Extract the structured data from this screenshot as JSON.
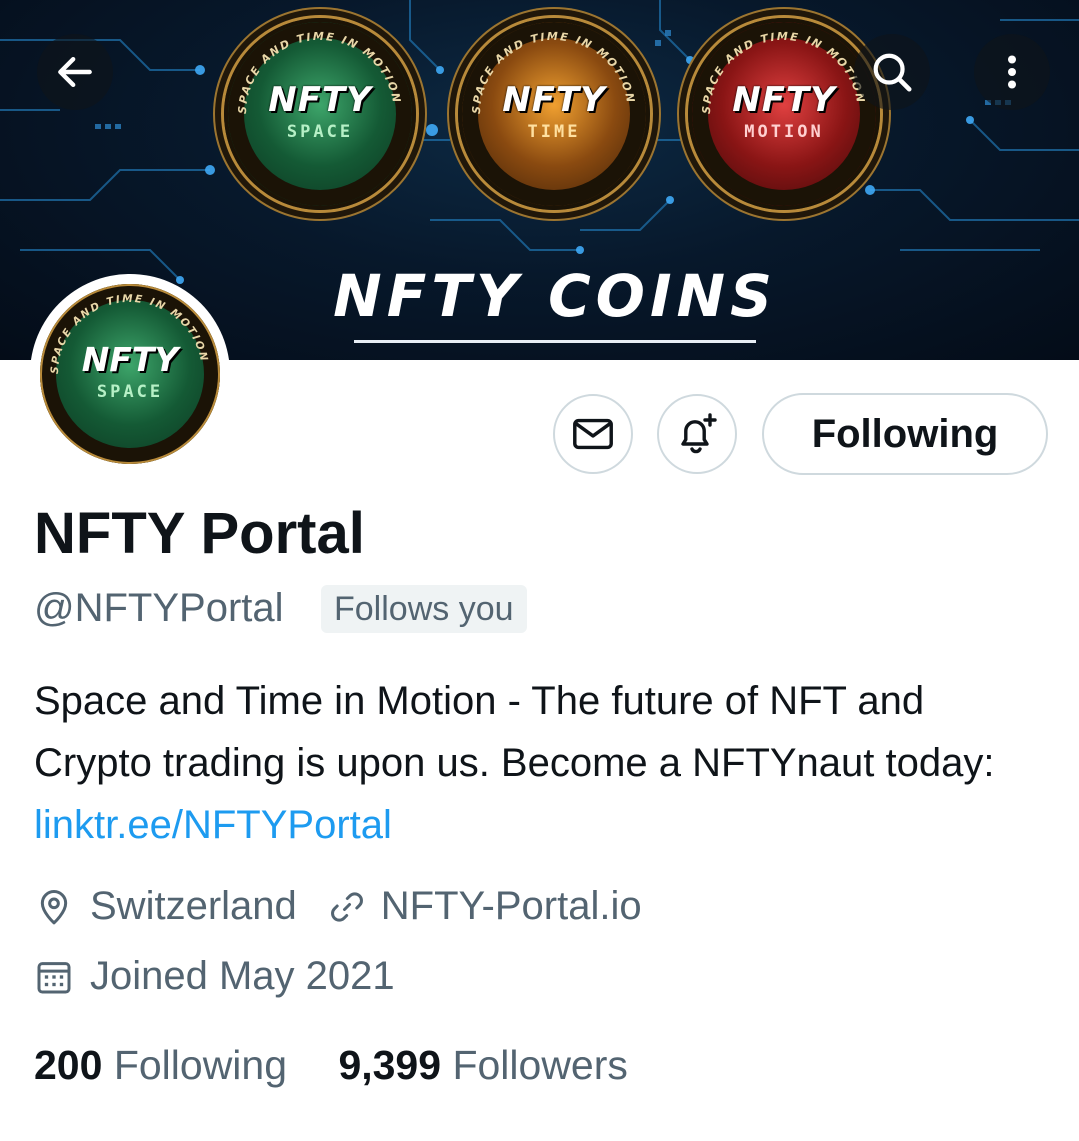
{
  "header": {
    "back_icon": "arrow-left-icon",
    "search_icon": "search-icon",
    "more_icon": "more-vertical-icon"
  },
  "banner": {
    "coin_ring_text": "SPACE AND TIME IN MOTION",
    "coins": [
      {
        "title": "NFTY",
        "subtitle": "SPACE",
        "color": "#1f7a45"
      },
      {
        "title": "NFTY",
        "subtitle": "TIME",
        "color": "#c8741a"
      },
      {
        "title": "NFTY",
        "subtitle": "MOTION",
        "color": "#b51e1e"
      }
    ],
    "title": "NFTY COINS"
  },
  "avatar": {
    "ring_text": "SPACE AND TIME IN MOTION",
    "title": "NFTY",
    "subtitle": "SPACE"
  },
  "actions": {
    "message_icon": "mail-icon",
    "notify_icon": "bell-plus-icon",
    "follow_label": "Following"
  },
  "profile": {
    "name": "NFTY Portal",
    "handle": "@NFTYPortal",
    "follows_you": "Follows you",
    "bio_text": "Space and Time in Motion - The future of NFT and Crypto trading is upon us. Become a NFTYnaut today: ",
    "bio_link": "linktr.ee/NFTYPortal",
    "location": "Switzerland",
    "website": "NFTY-Portal.io",
    "joined": "Joined May 2021",
    "following_count": "200",
    "following_label": "Following",
    "followers_count": "9,399",
    "followers_label": "Followers"
  },
  "colors": {
    "accent_link": "#1d9bf0",
    "text_primary": "#0f1419",
    "text_secondary": "#536471",
    "border": "#cfd9de"
  }
}
